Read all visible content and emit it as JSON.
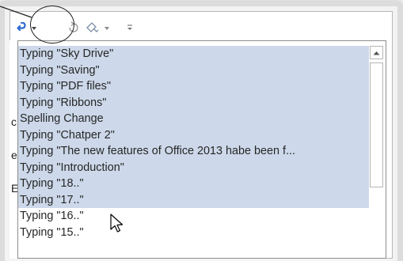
{
  "toolbar": {
    "undo_icon": "undo-icon",
    "redo_icon": "redo-icon",
    "touch_mode_icon": "touch-mode-icon",
    "customize_icon": "customize-qat-icon"
  },
  "undo_list": {
    "items": [
      {
        "label": "Typing \"Sky Drive\"",
        "selected": true
      },
      {
        "label": "Typing \"Saving\"",
        "selected": true
      },
      {
        "label": "Typing \"PDF files\"",
        "selected": true
      },
      {
        "label": "Typing \"Ribbons\"",
        "selected": true
      },
      {
        "label": "Spelling Change",
        "selected": true
      },
      {
        "label": "Typing \"Chatper 2\"",
        "selected": true
      },
      {
        "label": "Typing \"The new features of Office 2013 habe been f...",
        "selected": true
      },
      {
        "label": "Typing \"Introduction\"",
        "selected": true
      },
      {
        "label": "Typing \"18..\"",
        "selected": true
      },
      {
        "label": "Typing \"17..\"",
        "selected": true
      },
      {
        "label": "Typing \"16..\"",
        "selected": false
      },
      {
        "label": "Typing \"15..\"",
        "selected": false
      }
    ]
  },
  "background_text": {
    "left_chars": [
      "c",
      "e",
      "E"
    ]
  },
  "colors": {
    "selection": "#cdd9ea",
    "undo_icon": "#2e6bd1",
    "border": "#8e8e8e"
  }
}
